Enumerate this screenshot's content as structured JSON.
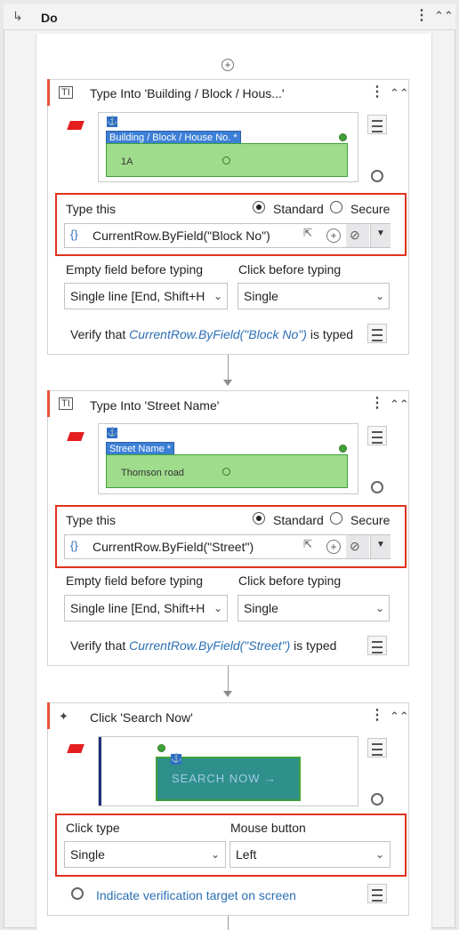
{
  "do_block": {
    "label": "Do"
  },
  "activities": [
    {
      "title": "Type Into 'Building / Block / Hous...'",
      "target_label": "Building / Block / House No. *",
      "target_value": "1A",
      "type_this_label": "Type this",
      "mode_standard": "Standard",
      "mode_secure": "Secure",
      "expression": "CurrentRow.ByField(\"Block No\")",
      "empty_field_label": "Empty field before typing",
      "empty_field_value": "Single line [End, Shift+H",
      "click_before_label": "Click before typing",
      "click_before_value": "Single",
      "verify_prefix": "Verify that ",
      "verify_expr": "CurrentRow.ByField(\"Block No\")",
      "verify_suffix": " is typed"
    },
    {
      "title": "Type Into 'Street Name'",
      "target_label": "Street Name *",
      "target_value": "Thomson road",
      "type_this_label": "Type this",
      "mode_standard": "Standard",
      "mode_secure": "Secure",
      "expression": "CurrentRow.ByField(\"Street\")",
      "empty_field_label": "Empty field before typing",
      "empty_field_value": "Single line [End, Shift+H",
      "click_before_label": "Click before typing",
      "click_before_value": "Single",
      "verify_prefix": "Verify that ",
      "verify_expr": "CurrentRow.ByField(\"Street\")",
      "verify_suffix": " is typed"
    },
    {
      "title": "Click 'Search Now'",
      "target_text": "SEARCH NOW →",
      "click_type_label": "Click type",
      "click_type_value": "Single",
      "mouse_button_label": "Mouse button",
      "mouse_button_value": "Left",
      "verification_link": "Indicate verification target on screen"
    }
  ],
  "colors": {
    "accent_red": "#e2321e",
    "target_green": "#9fdc8c",
    "anchor_blue": "#2f6bc9",
    "link_blue": "#2b6fb5"
  }
}
